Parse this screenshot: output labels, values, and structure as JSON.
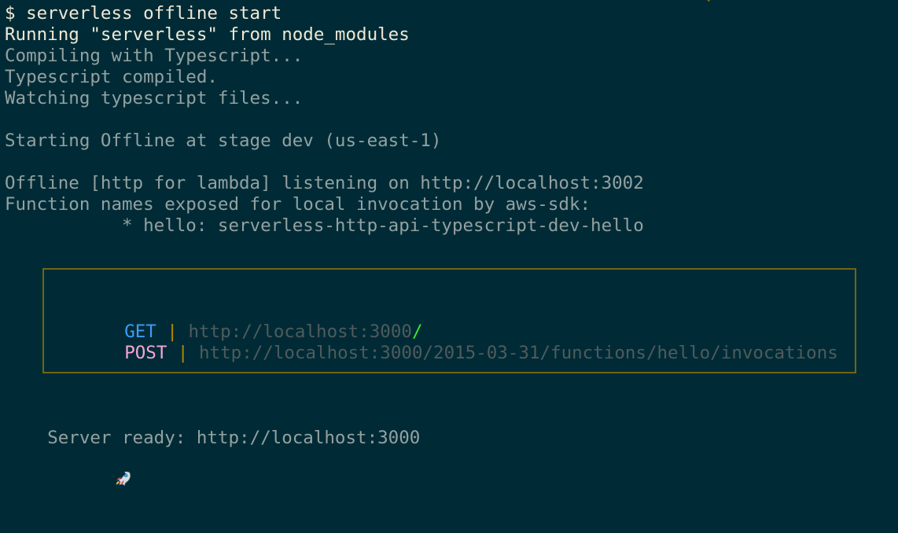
{
  "window": {
    "title": ""
  },
  "terminal": {
    "colors": {
      "background": "#002b36",
      "text": "#93a1a1",
      "bright_text": "#eee8d5",
      "border": "#b58900",
      "get": "#3f9cf5",
      "post": "#f4a6d6",
      "separator": "#b58900",
      "url_dim": "#4f5b5c",
      "slash": "#3ee82f"
    },
    "top_clipped_fragment": "    ,      ,      ,    ;    ",
    "lines": {
      "command": "$ serverless offline start",
      "running": "Running \"serverless\" from node_modules",
      "compiling": "Compiling with Typescript...",
      "compiled": "Typescript compiled.",
      "watching": "Watching typescript files...",
      "starting": "Starting Offline at stage dev (us-east-1)",
      "offline_listening": "Offline [http for lambda] listening on http://localhost:3002",
      "function_names": "Function names exposed for local invocation by aws-sdk:",
      "function_item": "           * hello: serverless-http-api-typescript-dev-hello",
      "server_ready": "Server ready: http://localhost:3000"
    },
    "routes": [
      {
        "method": "GET",
        "separator": "|",
        "url": "http://localhost:3000",
        "suffix": "/"
      },
      {
        "method": "POST",
        "separator": "|",
        "url": "http://localhost:3000/2015-03-31/functions/hello/invocations",
        "suffix": ""
      }
    ],
    "status_icon": "rocket-icon"
  }
}
